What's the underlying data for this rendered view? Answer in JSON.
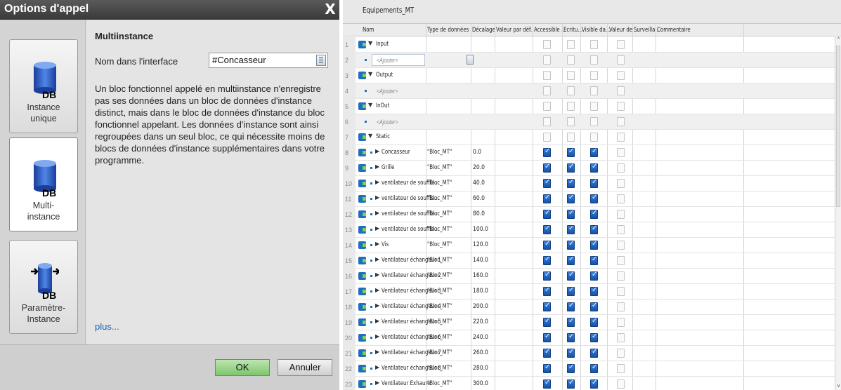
{
  "dialog": {
    "title": "Options d'appel",
    "close_glyph": "X",
    "options": [
      {
        "label_line1": "Instance",
        "label_line2": "unique",
        "icon": "db-icon"
      },
      {
        "label_line1": "Multi-",
        "label_line2": "instance",
        "icon": "db-icon"
      },
      {
        "label_line1": "Paramètre-",
        "label_line2": "Instance",
        "icon": "db-parameter-icon"
      }
    ],
    "icon_text": "DB",
    "section_title": "Multiinstance",
    "interface_label": "Nom dans l'interface",
    "interface_value": "#Concasseur",
    "description": "Un bloc fonctionnel appelé en multiinstance n'enregistre pas ses données dans un bloc de données d'instance distinct, mais dans le bloc de données d'instance du bloc fonctionnel appelant. Les données d'instance sont ainsi regroupées dans un seul bloc, ce qui nécessite moins de blocs de données d'instance supplémentaires dans votre programme.",
    "more_link": "plus...",
    "ok_label": "OK",
    "cancel_label": "Annuler"
  },
  "table": {
    "title": "Equipements_MT",
    "columns": [
      "Nom",
      "Type de données",
      "Décalage",
      "Valeur par déf.",
      "Accessible ...",
      "Ecritu...",
      "Visible da...",
      "Valeur de ...",
      "Surveilla...",
      "Commentaire"
    ],
    "add_placeholder": "<Ajouter>",
    "rows": [
      {
        "num": "1",
        "kind": "section",
        "name": "Input",
        "type": "",
        "offset": "",
        "checks": [
          false,
          false,
          false,
          false
        ]
      },
      {
        "num": "2",
        "kind": "add-edit",
        "name": "<Ajouter>",
        "type": "",
        "offset": "",
        "checks": [
          false,
          false,
          false,
          false
        ]
      },
      {
        "num": "3",
        "kind": "section",
        "name": "Output",
        "type": "",
        "offset": "",
        "checks": [
          false,
          false,
          false,
          false
        ]
      },
      {
        "num": "4",
        "kind": "add",
        "name": "<Ajouter>",
        "type": "",
        "offset": "",
        "checks": [
          false,
          false,
          false,
          false
        ]
      },
      {
        "num": "5",
        "kind": "section",
        "name": "InOut",
        "type": "",
        "offset": "",
        "checks": [
          false,
          false,
          false,
          false
        ]
      },
      {
        "num": "6",
        "kind": "add",
        "name": "<Ajouter>",
        "type": "",
        "offset": "",
        "checks": [
          false,
          false,
          false,
          false
        ]
      },
      {
        "num": "7",
        "kind": "section",
        "name": "Static",
        "type": "",
        "offset": "",
        "checks": [
          false,
          false,
          false,
          false
        ]
      },
      {
        "num": "8",
        "kind": "item",
        "name": "Concasseur",
        "type": "\"Bloc_MT\"",
        "offset": "0.0",
        "checks": [
          true,
          true,
          true,
          false
        ]
      },
      {
        "num": "9",
        "kind": "item",
        "name": "Grille",
        "type": "\"Bloc_MT\"",
        "offset": "20.0",
        "checks": [
          true,
          true,
          true,
          false
        ]
      },
      {
        "num": "10",
        "kind": "item",
        "name": "ventilateur de souffla...",
        "type": "\"Bloc_MT\"",
        "offset": "40.0",
        "checks": [
          true,
          true,
          true,
          false
        ]
      },
      {
        "num": "11",
        "kind": "item",
        "name": "ventilateur de souffla...",
        "type": "\"Bloc_MT\"",
        "offset": "60.0",
        "checks": [
          true,
          true,
          true,
          false
        ]
      },
      {
        "num": "12",
        "kind": "item",
        "name": "ventilateur de souffla...",
        "type": "\"Bloc_MT\"",
        "offset": "80.0",
        "checks": [
          true,
          true,
          true,
          false
        ]
      },
      {
        "num": "13",
        "kind": "item",
        "name": "ventilateur de souffla...",
        "type": "\"Bloc_MT\"",
        "offset": "100.0",
        "checks": [
          true,
          true,
          true,
          false
        ]
      },
      {
        "num": "14",
        "kind": "item",
        "name": "Vis",
        "type": "\"Bloc_MT\"",
        "offset": "120.0",
        "checks": [
          true,
          true,
          true,
          false
        ]
      },
      {
        "num": "15",
        "kind": "item",
        "name": "Ventilateur échangeur 1",
        "type": "\"Bloc_MT\"",
        "offset": "140.0",
        "checks": [
          true,
          true,
          true,
          false
        ]
      },
      {
        "num": "16",
        "kind": "item",
        "name": "Ventilateur échangeur 2",
        "type": "\"Bloc_MT\"",
        "offset": "160.0",
        "checks": [
          true,
          true,
          true,
          false
        ]
      },
      {
        "num": "17",
        "kind": "item",
        "name": "Ventilateur échangeur 3",
        "type": "\"Bloc_MT\"",
        "offset": "180.0",
        "checks": [
          true,
          true,
          true,
          false
        ]
      },
      {
        "num": "18",
        "kind": "item",
        "name": "Ventilateur échangeur 4",
        "type": "\"Bloc_MT\"",
        "offset": "200.0",
        "checks": [
          true,
          true,
          true,
          false
        ]
      },
      {
        "num": "19",
        "kind": "item",
        "name": "Ventilateur échangeur 5",
        "type": "\"Bloc_MT\"",
        "offset": "220.0",
        "checks": [
          true,
          true,
          true,
          false
        ]
      },
      {
        "num": "20",
        "kind": "item",
        "name": "Ventilateur échangeur 6",
        "type": "\"Bloc_MT\"",
        "offset": "240.0",
        "checks": [
          true,
          true,
          true,
          false
        ]
      },
      {
        "num": "21",
        "kind": "item",
        "name": "Ventilateur échangeur 7",
        "type": "\"Bloc_MT\"",
        "offset": "260.0",
        "checks": [
          true,
          true,
          true,
          false
        ]
      },
      {
        "num": "22",
        "kind": "item",
        "name": "Ventilateur échangeur 8",
        "type": "\"Bloc_MT\"",
        "offset": "280.0",
        "checks": [
          true,
          true,
          true,
          false
        ]
      },
      {
        "num": "23",
        "kind": "item",
        "name": "Ventilateur Exhaure",
        "type": "\"Bloc_MT\"",
        "offset": "300.0",
        "checks": [
          true,
          true,
          true,
          false
        ]
      }
    ]
  }
}
